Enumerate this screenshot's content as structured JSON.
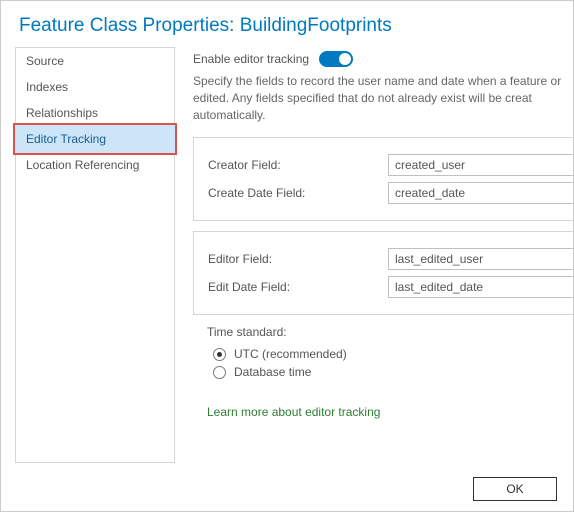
{
  "window": {
    "title": "Feature Class Properties: BuildingFootprints"
  },
  "sidebar": {
    "items": [
      {
        "label": "Source",
        "selected": false
      },
      {
        "label": "Indexes",
        "selected": false
      },
      {
        "label": "Relationships",
        "selected": false
      },
      {
        "label": "Editor Tracking",
        "selected": true
      },
      {
        "label": "Location Referencing",
        "selected": false
      }
    ]
  },
  "enable": {
    "label": "Enable editor tracking",
    "on": true
  },
  "description": "Specify the fields to record the user name and date when a feature or edited. Any fields specified that do not already exist will be creat automatically.",
  "fields": {
    "group1": [
      {
        "label": "Creator Field:",
        "value": "created_user"
      },
      {
        "label": "Create Date Field:",
        "value": "created_date"
      }
    ],
    "group2": [
      {
        "label": "Editor Field:",
        "value": "last_edited_user"
      },
      {
        "label": "Edit Date Field:",
        "value": "last_edited_date"
      }
    ]
  },
  "time": {
    "label": "Time standard:",
    "options": [
      {
        "label": "UTC (recommended)",
        "checked": true
      },
      {
        "label": "Database time",
        "checked": false
      }
    ]
  },
  "learn_link": "Learn more about editor tracking",
  "buttons": {
    "ok": "OK"
  }
}
